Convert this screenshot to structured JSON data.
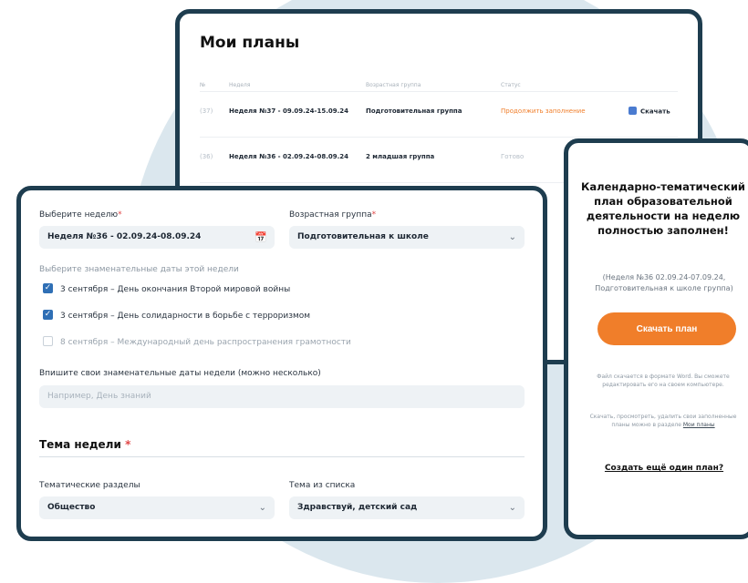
{
  "plans": {
    "title": "Мои планы",
    "columns": [
      "№",
      "Неделя",
      "Возрастная группа",
      "Статус"
    ],
    "rows": [
      {
        "idx": "(37)",
        "week": "Неделя №37 - 09.09.24-15.09.24",
        "group": "Подготовительная группа",
        "status": "Продолжить заполнение",
        "action": "Скачать"
      },
      {
        "idx": "(36)",
        "week": "Неделя №36 - 02.09.24-08.09.24",
        "group": "2 младшая группа",
        "status": "Готово",
        "action": ""
      }
    ],
    "peek_status": "...ие"
  },
  "form": {
    "week_label": "Выберите неделю",
    "week_value": "Неделя №36 - 02.09.24-08.09.24",
    "age_label": "Возрастная группа",
    "age_value": "Подготовительная к школе",
    "dates_label": "Выберите знаменательные даты этой недели",
    "dates": [
      {
        "text": "3 сентября – День окончания Второй мировой войны",
        "checked": true
      },
      {
        "text": "3 сентября – День солидарности в борьбе с терроризмом",
        "checked": true
      },
      {
        "text": "8 сентября – Международный день распространения грамотности",
        "checked": false
      }
    ],
    "custom_label": "Впишите свои знаменательные даты недели (можно несколько)",
    "custom_placeholder": "Например, День знаний",
    "theme_title": "Тема недели",
    "sections_label": "Тематические разделы",
    "sections_value": "Общество",
    "topic_label": "Тема из списка",
    "topic_value": "Здравствуй, детский сад"
  },
  "done": {
    "title": "Календарно-тематический план образовательной деятельности на неделю полностью заполнен!",
    "subtitle": "(Неделя №36 02.09.24-07.09.24, Подготовительная к школе группа)",
    "download_button": "Скачать план",
    "note1": "Файл скачается в формате Word. Вы сможете редактировать его на своем компьютере.",
    "note2_prefix": "Скачать, просмотреть, удалить свои заполненные планы можно в разделе",
    "note2_link": "Мои планы",
    "create_link": "Создать ещё один план?"
  },
  "colors": {
    "accent": "#f07e2a",
    "frame": "#1e3d4f",
    "check": "#2f6fb5",
    "background_circle": "#dbe7ee"
  }
}
